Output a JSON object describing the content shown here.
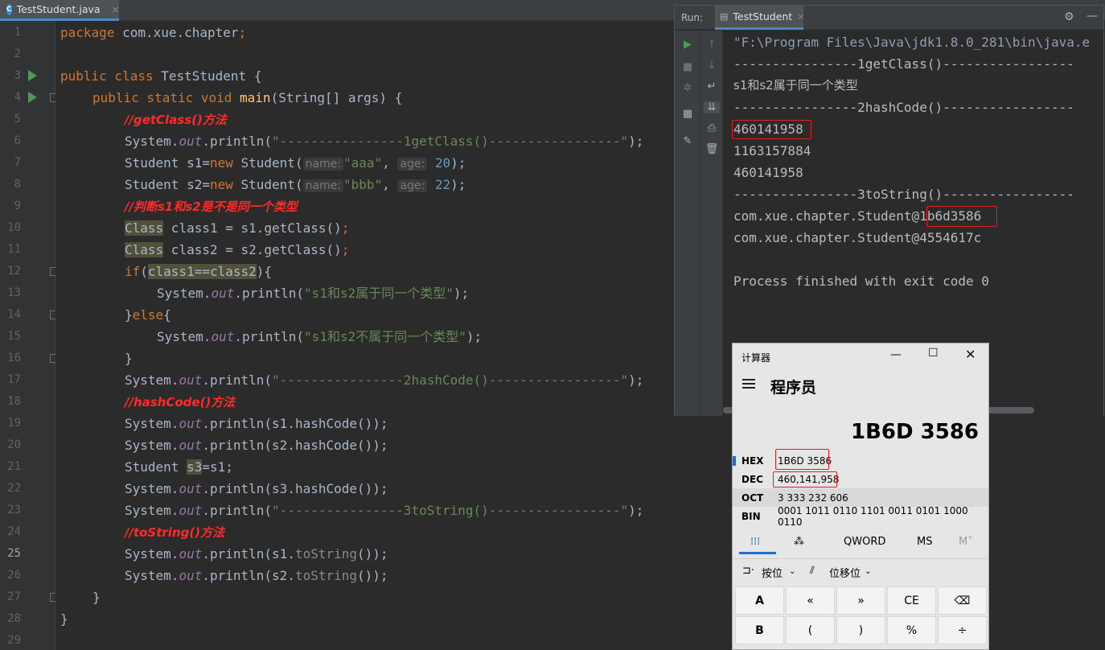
{
  "editor_tab": {
    "icon": "C",
    "label": "TestStudent.java",
    "close": "×"
  },
  "code": {
    "line_numbers": [
      "1",
      "2",
      "3",
      "4",
      "5",
      "6",
      "7",
      "8",
      "9",
      "10",
      "11",
      "12",
      "13",
      "14",
      "15",
      "16",
      "17",
      "18",
      "19",
      "20",
      "21",
      "22",
      "23",
      "24",
      "25",
      "26",
      "27",
      "28",
      "29"
    ],
    "current_line": "25",
    "l1_kw": "package",
    "l1_rest": " com.xue.chapter",
    "l1_end": ";",
    "l3_kw": "public class",
    "l3_rest": " TestStudent {",
    "l4_kw": "public static void",
    "l4_fn": "main",
    "l4_rest": "(String[] args) {",
    "l5_comment": "//getClass()方法",
    "sys": "System.",
    "out": "out",
    "println": ".println(",
    "close": ");",
    "l6_str": "\"----------------1getClass()-----------------\"",
    "l7_pre": "Student s1=",
    "new": "new",
    "l7_cls": " Student(",
    "hint_name": "name:",
    "l7_name": "\"aaa\"",
    "comma": ",",
    "hint_age": "age:",
    "l7_age": "20",
    "l8_pre": "Student s2=",
    "l8_name": "\"bbb\"",
    "l8_age": "22",
    "l9_comment": "//判断s1和s2是不是同一个类型",
    "l10_cls": "Class",
    "l10_rest": " class1 = s1.getClass()",
    "semi": ";",
    "l11_rest": " class2 = s2.getClass()",
    "l12_kw": "if",
    "l12_open": "(",
    "l12_cond": "class1==class2",
    "l12_close": "){",
    "l13_str": "\"s1和s2属于同一个类型\"",
    "l14_open": "}",
    "l14_kw": "else",
    "l14_brace": "{",
    "l15_str": "\"s1和s2不属于同一个类型\"",
    "l16": "}",
    "l17_str": "\"----------------2hashCode()-----------------\"",
    "l18_comment": "//hashCode()方法",
    "l19_arg": "s1.hashCode()",
    "l20_arg": "s2.hashCode()",
    "l21_pre": "Student ",
    "l21_var": "s3",
    "l21_rest": "=s1;",
    "l22_arg": "s3.hashCode()",
    "l23_str": "\"----------------3toString()-----------------\"",
    "l24_comment": "//toString()方法",
    "l25_pre": "s1.",
    "tostring": "toString",
    "l25_end": "()",
    "l26_pre": "s2.",
    "l27": "}",
    "l28": "}"
  },
  "run_panel": {
    "label": "Run:",
    "tab": "TestStudent",
    "close": "×",
    "console": [
      "\"F:\\Program Files\\Java\\jdk1.8.0_281\\bin\\java.e",
      "----------------1getClass()-----------------",
      "s1和s2属于同一个类型",
      "----------------2hashCode()-----------------",
      "460141958",
      "1163157884",
      "460141958",
      "----------------3toString()-----------------",
      "com.xue.chapter.Student@1b6d3586",
      "com.xue.chapter.Student@4554617c",
      "",
      "Process finished with exit code 0"
    ]
  },
  "calculator": {
    "title": "计算器",
    "mode": "程序员",
    "display": "1B6D 3586",
    "rows": [
      {
        "name": "HEX",
        "value": "1B6D 3586"
      },
      {
        "name": "DEC",
        "value": "460,141,958"
      },
      {
        "name": "OCT",
        "value": "3 333 232 606"
      },
      {
        "name": "BIN",
        "value": "0001 1011 0110 1101 0011 0101 1000 0110"
      }
    ],
    "word_size": "QWORD",
    "ms": "MS",
    "mplus": "M˅",
    "bitwise": "按位",
    "bitshift": "位移位",
    "keys_row1": [
      "A",
      "«",
      "»",
      "CE",
      "⌫"
    ],
    "keys_row2": [
      "B",
      "(",
      ")",
      "%",
      "÷"
    ]
  }
}
